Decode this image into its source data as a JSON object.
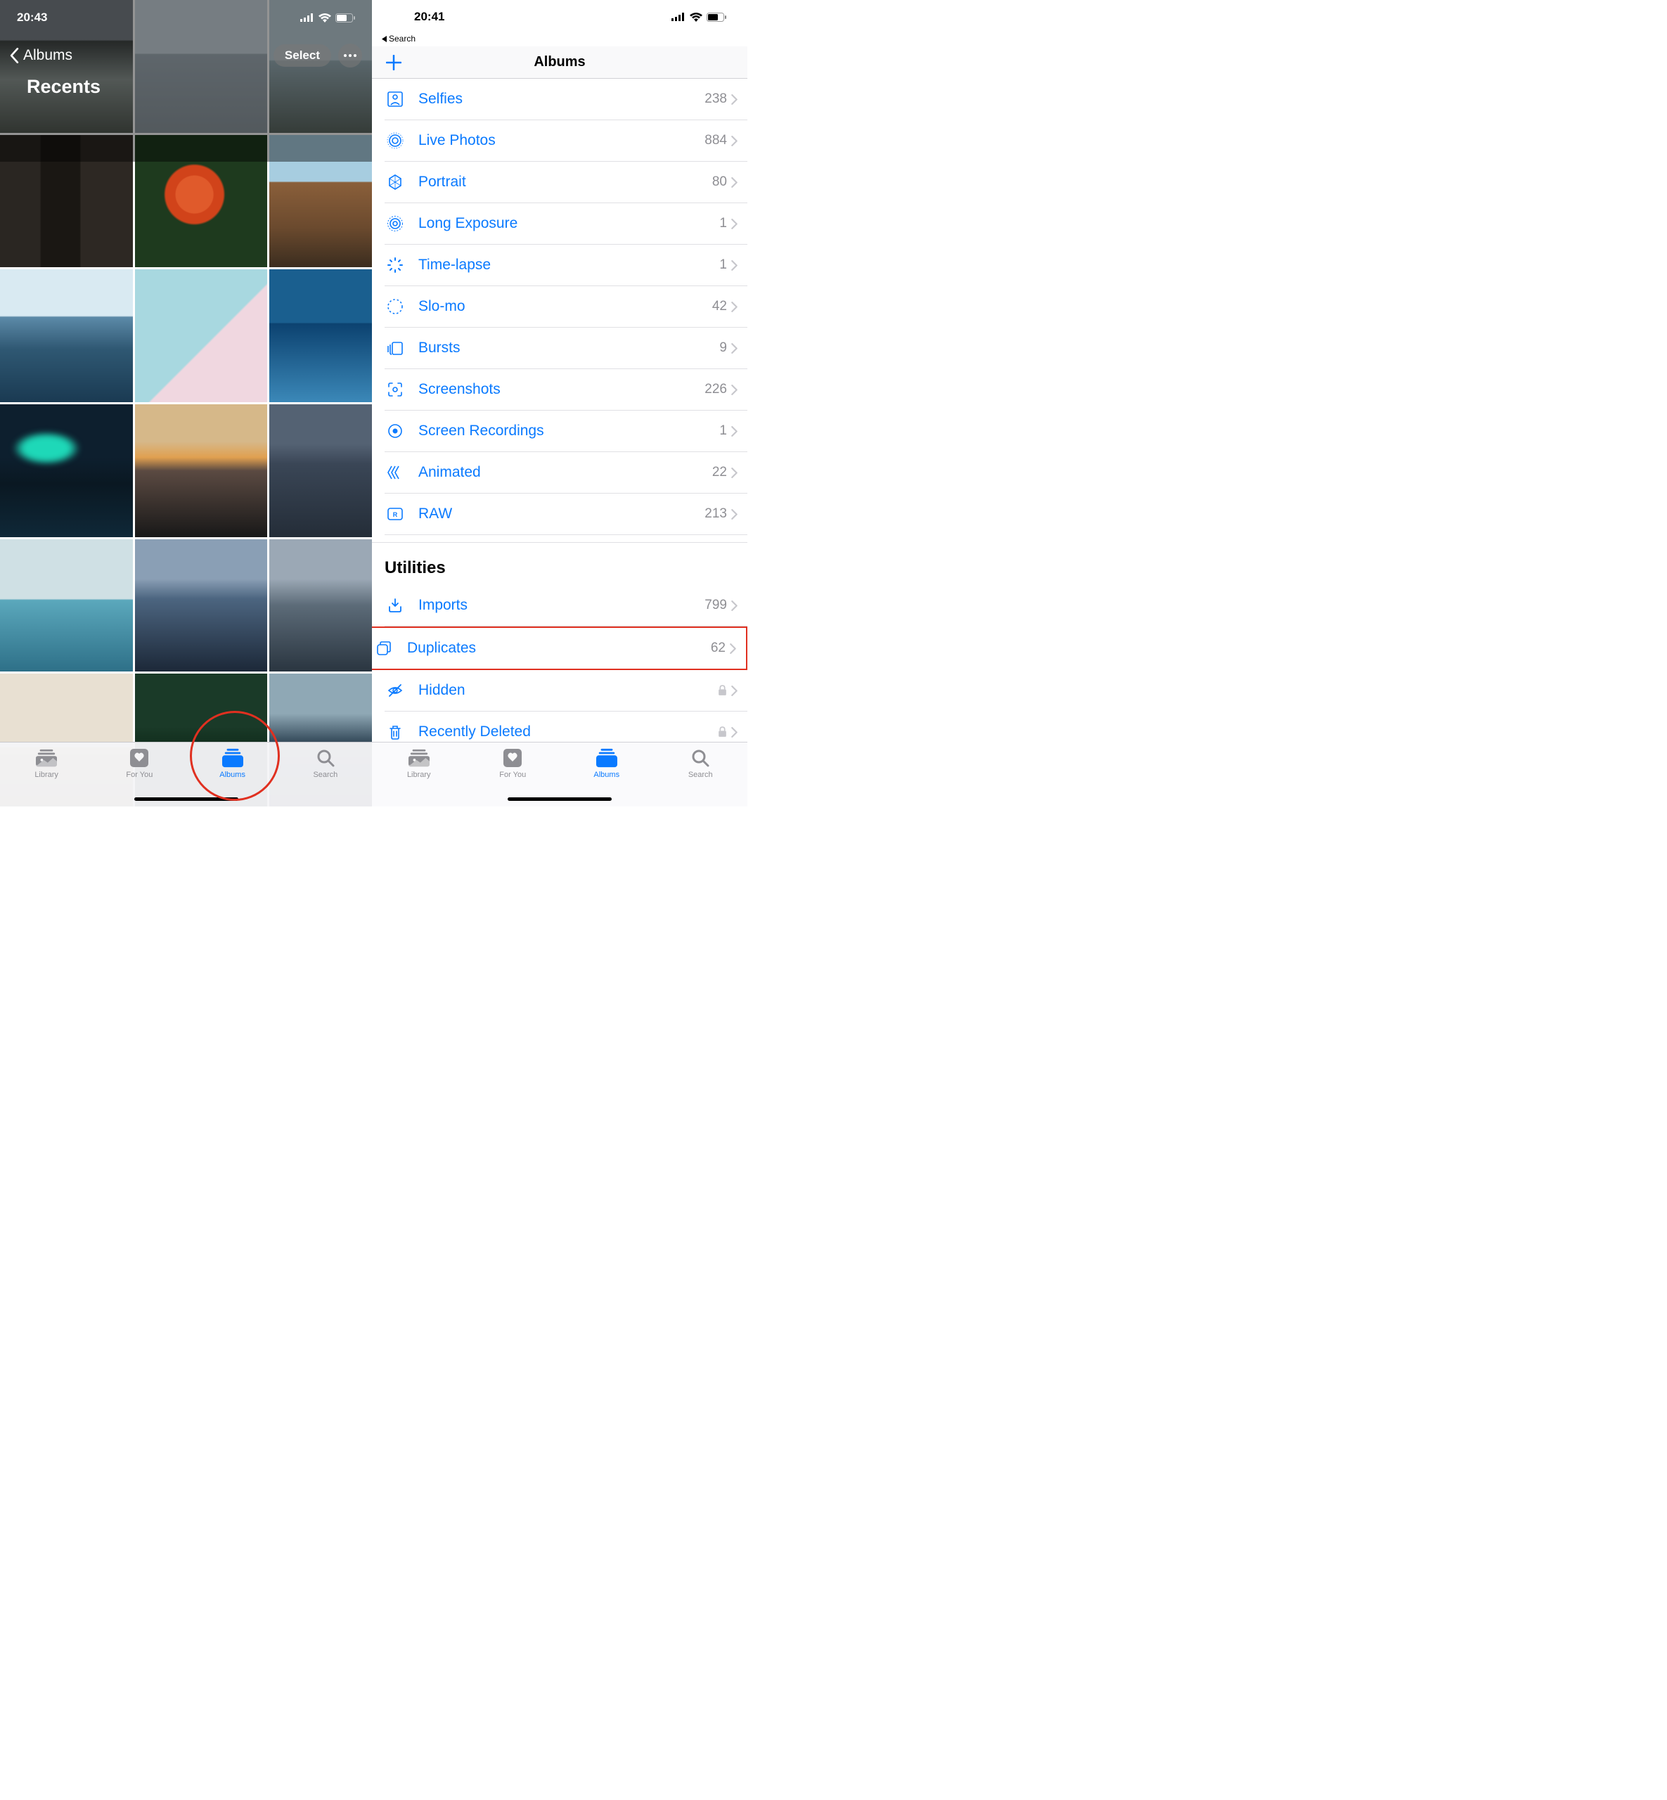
{
  "left": {
    "status_time": "20:43",
    "back_label": "Albums",
    "page_title": "Recents",
    "select_label": "Select",
    "tabs": {
      "library": "Library",
      "for_you": "For You",
      "albums": "Albums",
      "search": "Search"
    }
  },
  "right": {
    "status_time": "20:41",
    "breadcrumb": "Search",
    "title": "Albums",
    "media_types": [
      {
        "icon": "selfies-icon",
        "label": "Selfies",
        "count": "238"
      },
      {
        "icon": "live-photos-icon",
        "label": "Live Photos",
        "count": "884"
      },
      {
        "icon": "portrait-icon",
        "label": "Portrait",
        "count": "80"
      },
      {
        "icon": "long-exposure-icon",
        "label": "Long Exposure",
        "count": "1"
      },
      {
        "icon": "timelapse-icon",
        "label": "Time-lapse",
        "count": "1"
      },
      {
        "icon": "slomo-icon",
        "label": "Slo-mo",
        "count": "42"
      },
      {
        "icon": "bursts-icon",
        "label": "Bursts",
        "count": "9"
      },
      {
        "icon": "screenshots-icon",
        "label": "Screenshots",
        "count": "226"
      },
      {
        "icon": "screen-recordings-icon",
        "label": "Screen Recordings",
        "count": "1"
      },
      {
        "icon": "animated-icon",
        "label": "Animated",
        "count": "22"
      },
      {
        "icon": "raw-icon",
        "label": "RAW",
        "count": "213"
      }
    ],
    "utilities_header": "Utilities",
    "utilities": [
      {
        "icon": "imports-icon",
        "label": "Imports",
        "count": "799",
        "locked": false,
        "highlight": false
      },
      {
        "icon": "duplicates-icon",
        "label": "Duplicates",
        "count": "62",
        "locked": false,
        "highlight": true
      },
      {
        "icon": "hidden-icon",
        "label": "Hidden",
        "count": "",
        "locked": true,
        "highlight": false
      },
      {
        "icon": "recently-deleted-icon",
        "label": "Recently Deleted",
        "count": "",
        "locked": true,
        "highlight": false
      }
    ],
    "tabs": {
      "library": "Library",
      "for_you": "For You",
      "albums": "Albums",
      "search": "Search"
    }
  }
}
